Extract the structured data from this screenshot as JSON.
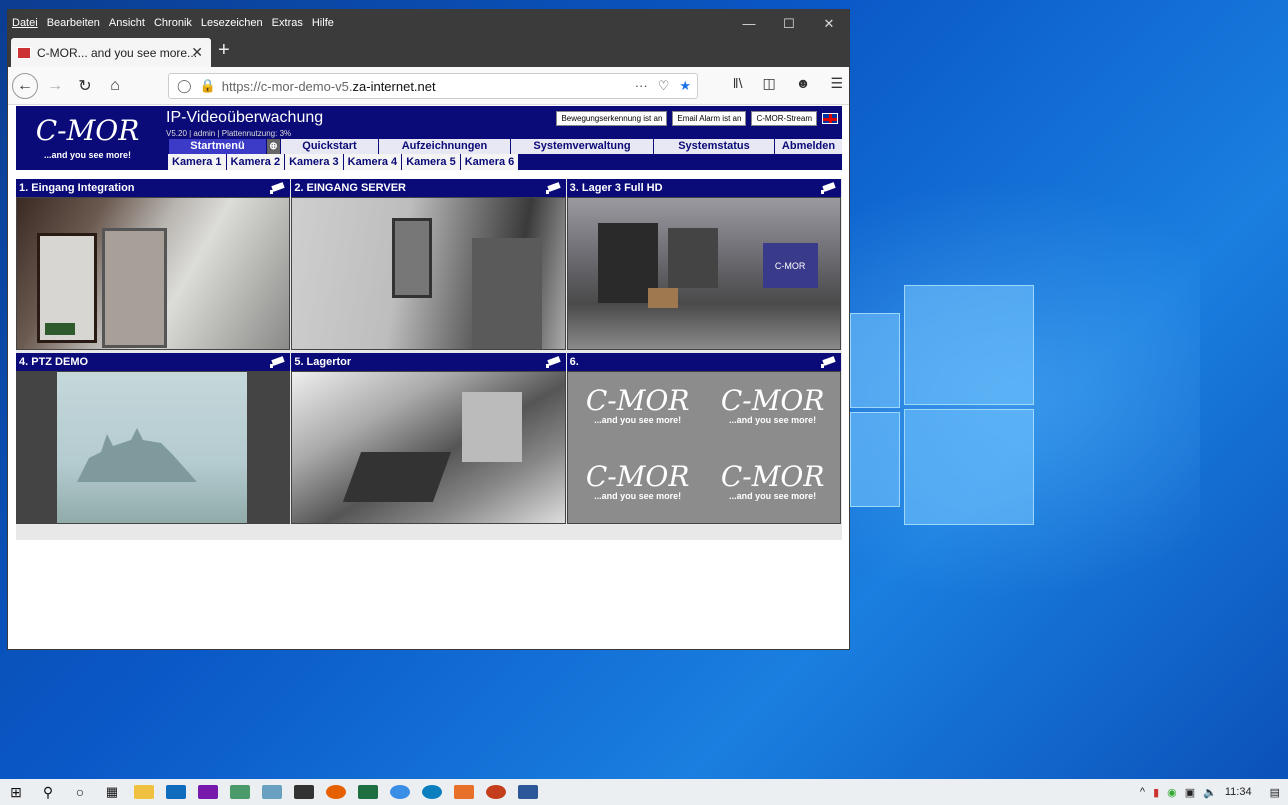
{
  "menubar": {
    "items": [
      "Datei",
      "Bearbeiten",
      "Ansicht",
      "Chronik",
      "Lesezeichen",
      "Extras",
      "Hilfe"
    ]
  },
  "tab": {
    "title": "C-MOR... and you see more..."
  },
  "url": {
    "prefix": "https://c-mor-demo-v5.",
    "domain": "za-internet.net",
    "more": "···"
  },
  "app": {
    "logo": "C-MOR",
    "tagline": "...and you see more!",
    "title": "IP-Videoüberwachung",
    "subtitle": "V5.20 | admin | Plattennutzung: 3%",
    "buttons": {
      "motion": "Bewegungserkennung ist an",
      "email": "Email Alarm ist an",
      "stream": "C-MOR-Stream"
    },
    "nav": [
      "Startmenü",
      "Quickstart",
      "Aufzeichnungen",
      "Systemverwaltung",
      "Systemstatus",
      "Abmelden"
    ],
    "cams_nav": [
      "Kamera 1",
      "Kamera 2",
      "Kamera 3",
      "Kamera 4",
      "Kamera 5",
      "Kamera 6"
    ]
  },
  "cameras": [
    {
      "title": "1. Eingang Integration"
    },
    {
      "title": "2. EINGANG SERVER"
    },
    {
      "title": "3. Lager 3 Full HD"
    },
    {
      "title": "4. PTZ DEMO"
    },
    {
      "title": "5. Lagertor"
    },
    {
      "title": "6."
    }
  ],
  "placeholder": {
    "logo": "C-MOR",
    "tagline": "...and you see more!"
  },
  "tray": {
    "time": "11:34"
  }
}
